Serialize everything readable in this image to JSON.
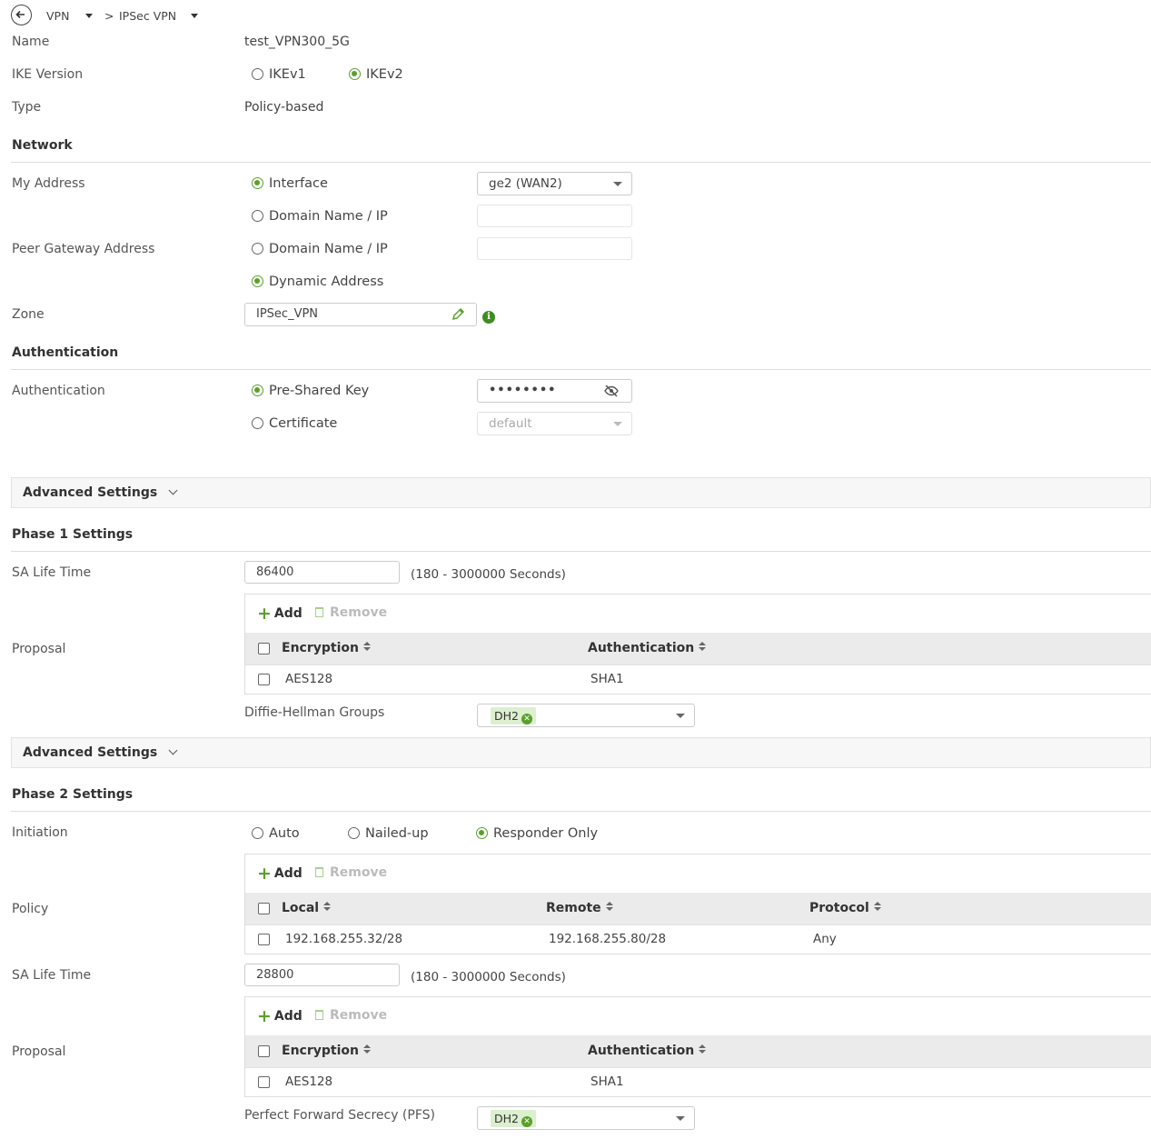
{
  "breadcrumb": {
    "root": "VPN",
    "sep": ">",
    "current": "IPSec VPN"
  },
  "general": {
    "name_label": "Name",
    "name_value": "test_VPN300_5G",
    "ike_label": "IKE Version",
    "ike_v1": "IKEv1",
    "ike_v2": "IKEv2",
    "type_label": "Type",
    "type_value": "Policy-based"
  },
  "network": {
    "title": "Network",
    "my_address_label": "My Address",
    "interface_option": "Interface",
    "interface_select": "ge2 (WAN2)",
    "domain_option": "Domain Name / IP",
    "peer_label": "Peer Gateway Address",
    "peer_domain_option": "Domain Name / IP",
    "dynamic_option": "Dynamic Address",
    "zone_label": "Zone",
    "zone_value": "IPSec_VPN"
  },
  "auth": {
    "title": "Authentication",
    "label": "Authentication",
    "psk_option": "Pre-Shared Key",
    "psk_value": "••••••••",
    "cert_option": "Certificate",
    "cert_select": "default"
  },
  "advanced_label": "Advanced Settings",
  "phase1": {
    "title": "Phase 1 Settings",
    "sa_label": "SA Life Time",
    "sa_value": "86400",
    "sa_hint": "(180 - 3000000 Seconds)",
    "proposal_label": "Proposal",
    "add": "Add",
    "remove": "Remove",
    "col_enc": "Encryption",
    "col_auth": "Authentication",
    "row_enc": "AES128",
    "row_auth": "SHA1",
    "dh_label": "Diffie-Hellman Groups",
    "dh_tag": "DH2"
  },
  "phase2": {
    "title": "Phase 2 Settings",
    "init_label": "Initiation",
    "init_auto": "Auto",
    "init_nailed": "Nailed-up",
    "init_responder": "Responder Only",
    "policy_label": "Policy",
    "add": "Add",
    "remove": "Remove",
    "col_local": "Local",
    "col_remote": "Remote",
    "col_protocol": "Protocol",
    "row_local": "192.168.255.32/28",
    "row_remote": "192.168.255.80/28",
    "row_protocol": "Any",
    "sa_label": "SA Life Time",
    "sa_value": "28800",
    "sa_hint": "(180 - 3000000 Seconds)",
    "proposal_label": "Proposal",
    "col_enc": "Encryption",
    "col_auth": "Authentication",
    "row_enc": "AES128",
    "row_auth": "SHA1",
    "pfs_label": "Perfect Forward Secrecy (PFS)",
    "pfs_tag": "DH2"
  }
}
